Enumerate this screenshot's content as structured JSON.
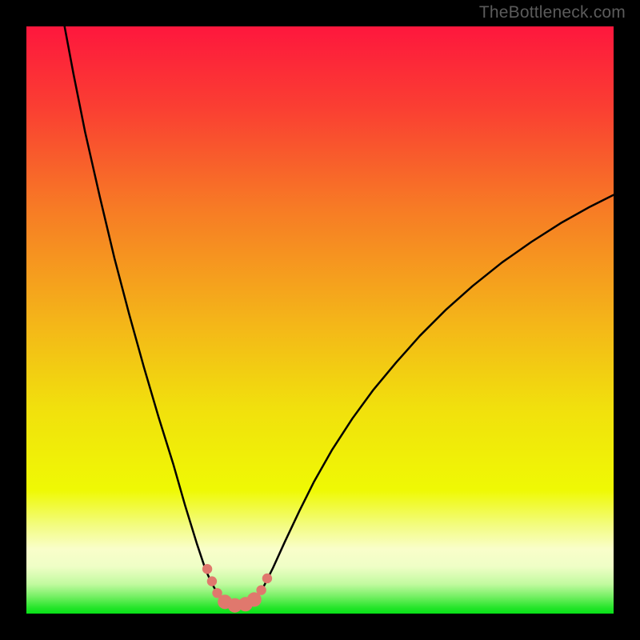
{
  "watermark": "TheBottleneck.com",
  "chart_data": {
    "type": "line",
    "title": "",
    "xlabel": "",
    "ylabel": "",
    "xlim": [
      0,
      100
    ],
    "ylim": [
      0,
      100
    ],
    "background_gradient_stops": [
      {
        "offset": 0.0,
        "color": "#fe173d"
      },
      {
        "offset": 0.14,
        "color": "#fa3f32"
      },
      {
        "offset": 0.31,
        "color": "#f77b25"
      },
      {
        "offset": 0.5,
        "color": "#f4b419"
      },
      {
        "offset": 0.65,
        "color": "#f1e00d"
      },
      {
        "offset": 0.79,
        "color": "#eff904"
      },
      {
        "offset": 0.85,
        "color": "#f3fc81"
      },
      {
        "offset": 0.89,
        "color": "#f9feca"
      },
      {
        "offset": 0.92,
        "color": "#effec6"
      },
      {
        "offset": 0.95,
        "color": "#c1fa9f"
      },
      {
        "offset": 0.97,
        "color": "#79f067"
      },
      {
        "offset": 0.99,
        "color": "#26e52a"
      },
      {
        "offset": 1.0,
        "color": "#07e117"
      }
    ],
    "series": [
      {
        "name": "bottleneck-curve",
        "color": "#000000",
        "width": 2.5,
        "points": [
          {
            "x": 6.5,
            "y": 100.0
          },
          {
            "x": 8.0,
            "y": 92.0
          },
          {
            "x": 10.0,
            "y": 82.0
          },
          {
            "x": 12.5,
            "y": 71.0
          },
          {
            "x": 15.0,
            "y": 60.5
          },
          {
            "x": 17.5,
            "y": 51.0
          },
          {
            "x": 20.0,
            "y": 42.0
          },
          {
            "x": 22.5,
            "y": 33.5
          },
          {
            "x": 25.0,
            "y": 25.5
          },
          {
            "x": 27.0,
            "y": 18.5
          },
          {
            "x": 29.0,
            "y": 12.0
          },
          {
            "x": 30.5,
            "y": 7.5
          },
          {
            "x": 31.5,
            "y": 5.3
          },
          {
            "x": 32.5,
            "y": 3.5
          },
          {
            "x": 33.5,
            "y": 2.0
          },
          {
            "x": 34.5,
            "y": 1.3
          },
          {
            "x": 35.5,
            "y": 1.1
          },
          {
            "x": 36.5,
            "y": 1.1
          },
          {
            "x": 37.5,
            "y": 1.3
          },
          {
            "x": 38.5,
            "y": 2.0
          },
          {
            "x": 39.5,
            "y": 3.2
          },
          {
            "x": 40.5,
            "y": 4.8
          },
          {
            "x": 42.0,
            "y": 7.8
          },
          {
            "x": 44.0,
            "y": 12.2
          },
          {
            "x": 46.5,
            "y": 17.5
          },
          {
            "x": 49.0,
            "y": 22.5
          },
          {
            "x": 52.0,
            "y": 27.8
          },
          {
            "x": 55.5,
            "y": 33.2
          },
          {
            "x": 59.0,
            "y": 38.0
          },
          {
            "x": 63.0,
            "y": 42.8
          },
          {
            "x": 67.0,
            "y": 47.3
          },
          {
            "x": 71.5,
            "y": 51.8
          },
          {
            "x": 76.0,
            "y": 55.8
          },
          {
            "x": 81.0,
            "y": 59.8
          },
          {
            "x": 86.0,
            "y": 63.3
          },
          {
            "x": 91.0,
            "y": 66.5
          },
          {
            "x": 96.0,
            "y": 69.3
          },
          {
            "x": 100.0,
            "y": 71.3
          }
        ]
      }
    ],
    "markers": {
      "color": "#e0786d",
      "radius_small": 6.2,
      "radius_large": 9.0,
      "points": [
        {
          "x": 30.8,
          "y": 7.6,
          "size": "small"
        },
        {
          "x": 31.6,
          "y": 5.5,
          "size": "small"
        },
        {
          "x": 32.5,
          "y": 3.5,
          "size": "small"
        },
        {
          "x": 33.8,
          "y": 2.0,
          "size": "large"
        },
        {
          "x": 35.5,
          "y": 1.4,
          "size": "large"
        },
        {
          "x": 37.3,
          "y": 1.6,
          "size": "large"
        },
        {
          "x": 38.8,
          "y": 2.4,
          "size": "large"
        },
        {
          "x": 40.0,
          "y": 4.0,
          "size": "small"
        },
        {
          "x": 41.0,
          "y": 6.0,
          "size": "small"
        }
      ]
    }
  }
}
